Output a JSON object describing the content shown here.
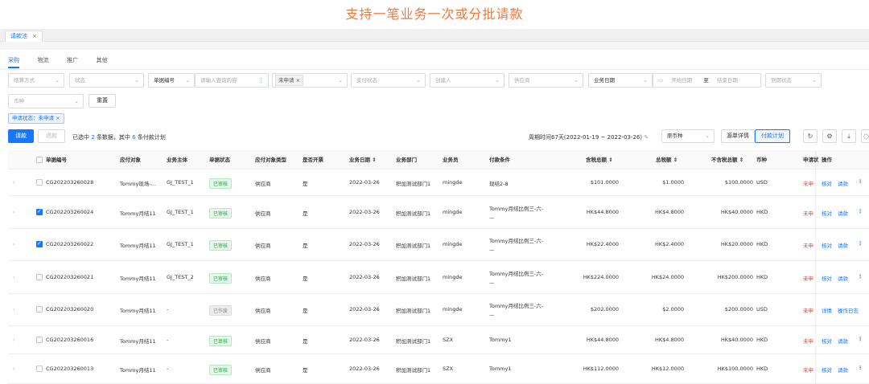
{
  "banner": {
    "title": "支持一笔业务一次或分批请款"
  },
  "window_tab": {
    "label": "请款池",
    "close": "×"
  },
  "subtabs": [
    "采购",
    "物流",
    "推广",
    "其他"
  ],
  "filters": {
    "row1": [
      {
        "placeholder": "结算方式"
      },
      {
        "placeholder": "状态"
      },
      {
        "value": "单据编号"
      },
      {
        "placeholder": "请输入查询内容"
      },
      {
        "tag": "未申请"
      },
      {
        "placeholder": "支付状态"
      },
      {
        "placeholder": "创建人"
      },
      {
        "placeholder": "供应商"
      },
      {
        "value": "业务日期"
      },
      {
        "start": "开始日期",
        "sep": "至",
        "end": "结束日期"
      },
      {
        "placeholder": "到期状态"
      }
    ],
    "currency_placeholder": "币种",
    "reset_label": "重置",
    "active_chip": "申请状态：未申请"
  },
  "toolbar": {
    "request_label": "请款",
    "pay_label": "退款",
    "selection_prefix": "已选中",
    "selected_count": "2",
    "selection_mid": "条数据，其中",
    "plan_count": "6",
    "selection_suffix": "条付款计划",
    "period": "周期时间67天(2022-01-19 ~ 2022-03-26)",
    "currency_select": "原币种",
    "detail_btn": "源单详情",
    "plan_btn": "付款计划"
  },
  "table": {
    "headers": [
      "单据编号",
      "应付对象",
      "业务主体",
      "单据状态",
      "应付对象类型",
      "是否开票",
      "业务日期",
      "业务部门",
      "业务员",
      "付款条件",
      "含税总额",
      "总税额",
      "不含税总额",
      "币种",
      "申请状",
      "操作"
    ],
    "rows": [
      {
        "id": "CG202203260028",
        "payee": "Tommy现场-...",
        "entity": "GJ_TEST_1",
        "status": "已审核",
        "ptype": "供应商",
        "invoice": "是",
        "date": "2022-03-26",
        "dept": "积加测试部门1",
        "staff": "mingde",
        "terms": "现结2-8",
        "terms2": "",
        "gross": "$101.0000",
        "tax": "$1.0000",
        "net": "$100.0000",
        "cur": "USD",
        "apply": "未申",
        "op1": "核对",
        "op2": "请款",
        "checked": false
      },
      {
        "id": "CG202203260024",
        "payee": "Tommy月结11",
        "entity": "GJ_TEST_1",
        "status": "已审核",
        "ptype": "供应商",
        "invoice": "是",
        "date": "2022-03-26",
        "dept": "积加测试部门1",
        "staff": "mingde",
        "terms": "Tommy月结比例三-六-",
        "terms2": "—",
        "gross": "HK$44.8000",
        "tax": "HK$4.8000",
        "net": "HK$40.0000",
        "cur": "HKD",
        "apply": "未申",
        "op1": "核对",
        "op2": "请款",
        "checked": true
      },
      {
        "id": "CG202203260022",
        "payee": "Tommy月结11",
        "entity": "GJ_TEST_1",
        "status": "已审核",
        "ptype": "供应商",
        "invoice": "是",
        "date": "2022-03-26",
        "dept": "积加测试部门1",
        "staff": "mingde",
        "terms": "Tommy月结比例三-六-",
        "terms2": "—",
        "gross": "HK$22.4000",
        "tax": "HK$2.4000",
        "net": "HK$20.0000",
        "cur": "HKD",
        "apply": "未申",
        "op1": "核对",
        "op2": "请款",
        "checked": true
      },
      {
        "id": "CG202203260021",
        "payee": "Tommy月结11",
        "entity": "GJ_TEST_2",
        "status": "已审核",
        "ptype": "供应商",
        "invoice": "是",
        "date": "2022-03-26",
        "dept": "积加测试部门1",
        "staff": "mingde",
        "terms": "Tommy月结比例三-六-",
        "terms2": "—",
        "gross": "HK$224.0000",
        "tax": "HK$24.0000",
        "net": "HK$200.0000",
        "cur": "HKD",
        "apply": "未申",
        "op1": "核对",
        "op2": "请款",
        "checked": false
      },
      {
        "id": "CG202203260020",
        "payee": "Tommy月结11",
        "entity": "-",
        "status": "已作废",
        "ptype": "供应商",
        "invoice": "是",
        "date": "2022-03-26",
        "dept": "积加测试部门1",
        "staff": "mingde",
        "terms": "Tommy月结比例三-六-",
        "terms2": "—",
        "gross": "$202.0000",
        "tax": "$2.0000",
        "net": "$200.0000",
        "cur": "USD",
        "apply": "未申",
        "op1": "详情",
        "op2": "操作日志",
        "checked": false
      },
      {
        "id": "CG202203260016",
        "payee": "Tommy月结11",
        "entity": "-",
        "status": "已审核",
        "ptype": "供应商",
        "invoice": "是",
        "date": "2022-03-26",
        "dept": "积加测试部门1",
        "staff": "SZX",
        "terms": "Tommy1",
        "terms2": "",
        "gross": "HK$44.8000",
        "tax": "HK$4.8000",
        "net": "HK$40.0000",
        "cur": "HKD",
        "apply": "未申",
        "op1": "核对",
        "op2": "请款",
        "checked": false
      },
      {
        "id": "CG202203260013",
        "payee": "Tommy月结11",
        "entity": "-",
        "status": "已审核",
        "ptype": "供应商",
        "invoice": "是",
        "date": "2022-03-26",
        "dept": "积加测试部门1",
        "staff": "SZX",
        "terms": "Tommy1",
        "terms2": "",
        "gross": "HK$112.0000",
        "tax": "HK$12.0000",
        "net": "HK$100.0000",
        "cur": "HKD",
        "apply": "未申",
        "op1": "核对",
        "op2": "请款",
        "checked": false
      }
    ]
  },
  "icons": {
    "expand": "chevron-right-icon",
    "refresh": "refresh-icon",
    "settings": "gear-icon",
    "download": "download-icon",
    "more": "more-vertical-icon"
  }
}
